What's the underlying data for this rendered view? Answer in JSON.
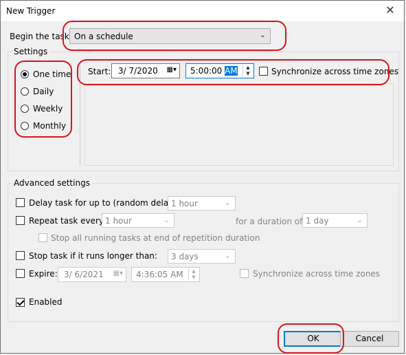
{
  "window": {
    "title": "New Trigger",
    "close_glyph": "✕"
  },
  "begin": {
    "label": "Begin the task:",
    "value": "On a schedule"
  },
  "settings": {
    "title": "Settings",
    "radios": [
      "One time",
      "Daily",
      "Weekly",
      "Monthly"
    ],
    "selected": "One time",
    "start_label": "Start:",
    "date": "3/  7/2020",
    "time_prefix": "5:00:00 ",
    "time_suffix": "AM",
    "sync_label": "Synchronize across time zones"
  },
  "advanced": {
    "title": "Advanced settings",
    "delay_label": "Delay task for up to (random delay):",
    "delay_value": "1 hour",
    "repeat_label": "Repeat task every:",
    "repeat_value": "1 hour",
    "duration_label": "for a duration of:",
    "duration_value": "1 day",
    "stop_all_label": "Stop all running tasks at end of repetition duration",
    "stop_label": "Stop task if it runs longer than:",
    "stop_value": "3 days",
    "expire_label": "Expire:",
    "expire_date": "3/  6/2021",
    "expire_time": "4:36:05 AM",
    "expire_sync_label": "Synchronize across time zones",
    "enabled_label": "Enabled"
  },
  "buttons": {
    "ok": "OK",
    "cancel": "Cancel"
  },
  "colors": {
    "annotation": "#d9141c",
    "accent": "#0078d7"
  }
}
